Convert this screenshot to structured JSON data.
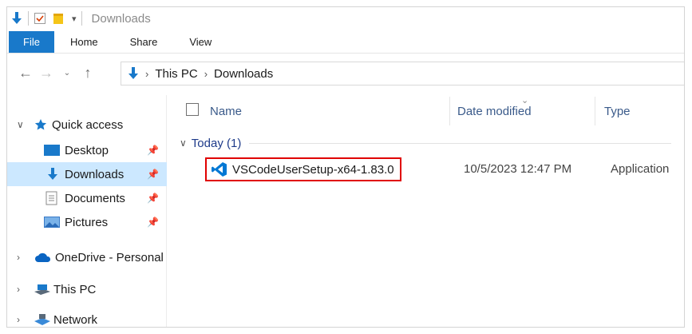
{
  "window": {
    "title": "Downloads"
  },
  "ribbon": {
    "tabs": [
      "File",
      "Home",
      "Share",
      "View"
    ]
  },
  "address": {
    "crumbs": [
      "This PC",
      "Downloads"
    ]
  },
  "nav": {
    "quick_access": "Quick access",
    "pinned": [
      {
        "label": "Desktop",
        "icon": "desktop-icon"
      },
      {
        "label": "Downloads",
        "icon": "download-arrow-icon",
        "selected": true
      },
      {
        "label": "Documents",
        "icon": "documents-icon"
      },
      {
        "label": "Pictures",
        "icon": "pictures-icon"
      }
    ],
    "onedrive": "OneDrive - Personal",
    "thispc": "This PC",
    "network": "Network"
  },
  "columns": {
    "name": "Name",
    "date": "Date modified",
    "type": "Type"
  },
  "group": {
    "label": "Today (1)"
  },
  "files": [
    {
      "name": "VSCodeUserSetup-x64-1.83.0",
      "date": "10/5/2023 12:47 PM",
      "type": "Application",
      "icon": "vscode-icon"
    }
  ],
  "colors": {
    "accent": "#1979ca",
    "selection": "#cce8ff",
    "highlight_box": "#e00000"
  }
}
